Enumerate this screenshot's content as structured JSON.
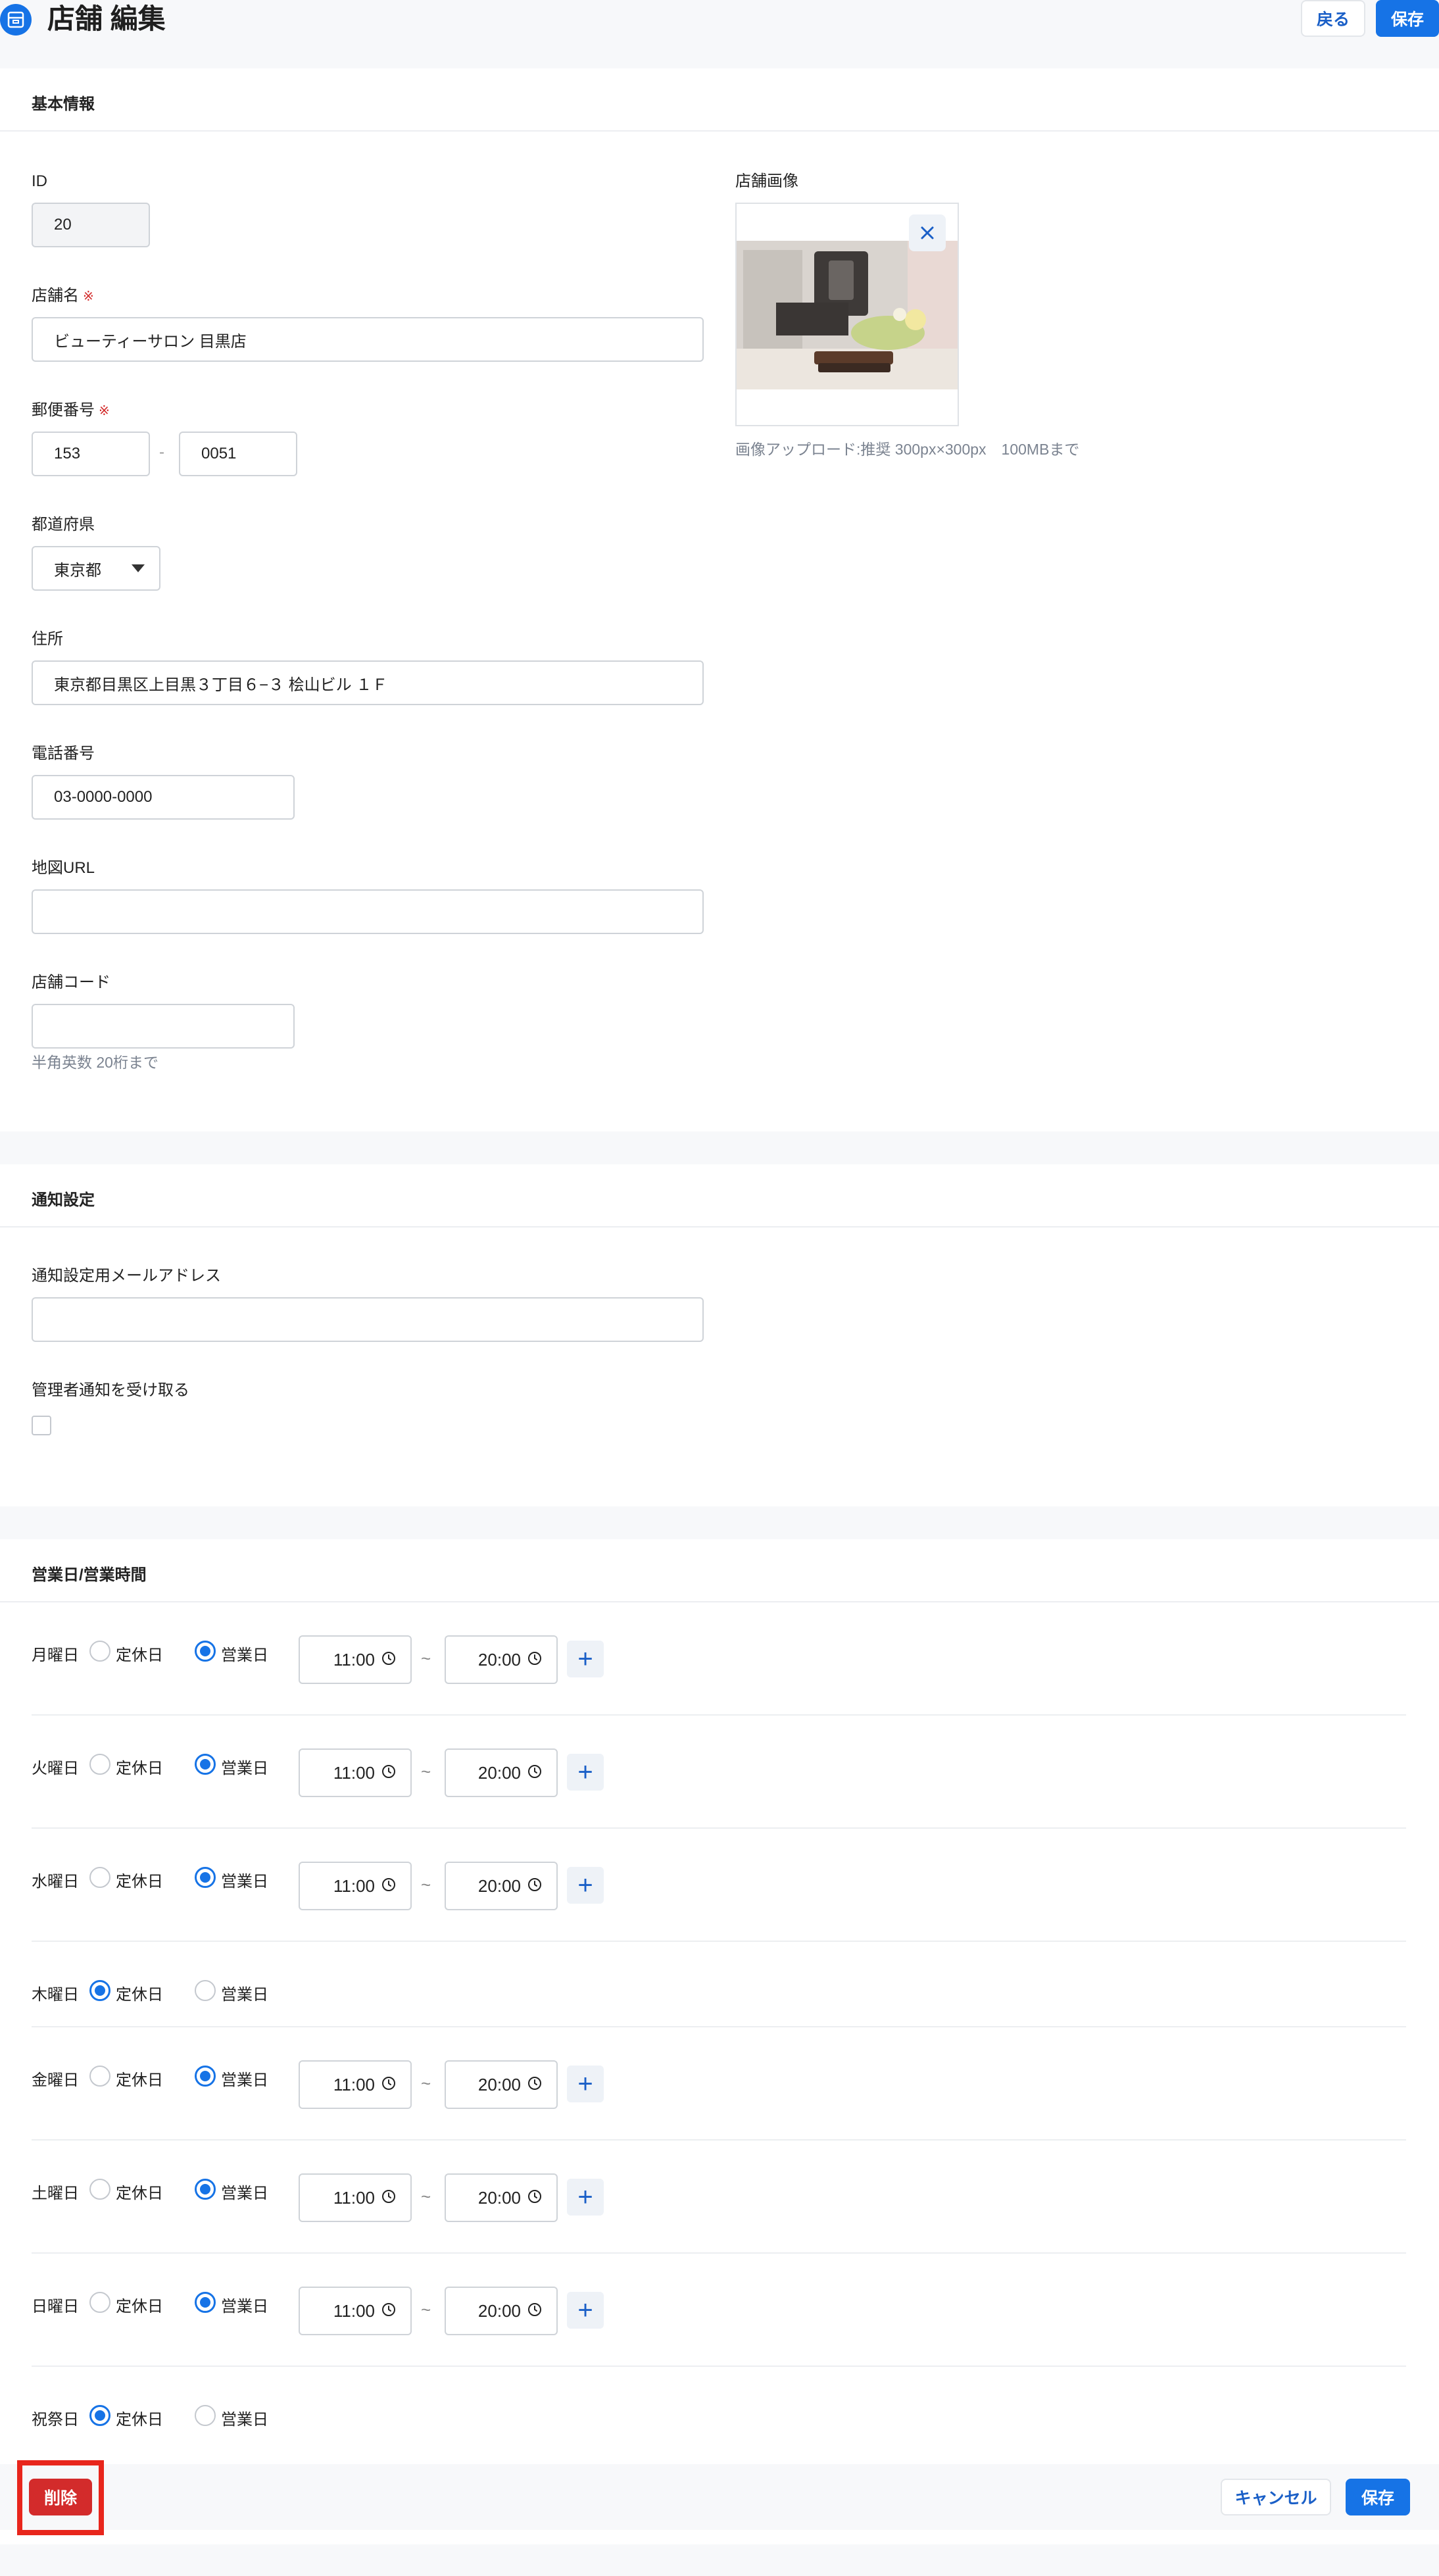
{
  "header": {
    "title": "店舗 編集",
    "back_label": "戻る",
    "save_label": "保存"
  },
  "basic": {
    "section_title": "基本情報",
    "id_label": "ID",
    "id_value": "20",
    "name_label": "店舗名",
    "name_value": "ビューティーサロン 目黒店",
    "required_mark": "※",
    "postal_label": "郵便番号",
    "postal1": "153",
    "postal_sep": "-",
    "postal2": "0051",
    "pref_label": "都道府県",
    "pref_value": "東京都",
    "address_label": "住所",
    "address_value": "東京都目黒区上目黒３丁目６−３ 桧山ビル １Ｆ",
    "phone_label": "電話番号",
    "phone_value": "03-0000-0000",
    "map_label": "地図URL",
    "map_value": "",
    "code_label": "店舗コード",
    "code_value": "",
    "code_hint": "半角英数 20桁まで",
    "image_label": "店舗画像",
    "image_hint": "画像アップロード:推奨 300px×300px　100MBまで"
  },
  "notify": {
    "section_title": "通知設定",
    "email_label": "通知設定用メールアドレス",
    "email_value": "",
    "admin_label": "管理者通知を受け取る",
    "admin_checked": false
  },
  "hours": {
    "section_title": "営業日/営業時間",
    "closed_label": "定休日",
    "open_label": "営業日",
    "days": [
      {
        "name": "月曜日",
        "open": true,
        "start": "11:00",
        "end": "20:00"
      },
      {
        "name": "火曜日",
        "open": true,
        "start": "11:00",
        "end": "20:00"
      },
      {
        "name": "水曜日",
        "open": true,
        "start": "11:00",
        "end": "20:00"
      },
      {
        "name": "木曜日",
        "open": false
      },
      {
        "name": "金曜日",
        "open": true,
        "start": "11:00",
        "end": "20:00"
      },
      {
        "name": "土曜日",
        "open": true,
        "start": "11:00",
        "end": "20:00"
      },
      {
        "name": "日曜日",
        "open": true,
        "start": "11:00",
        "end": "20:00"
      },
      {
        "name": "祝祭日",
        "open": false
      }
    ],
    "tilde": "~",
    "plus": "+"
  },
  "footer": {
    "delete_label": "削除",
    "cancel_label": "キャンセル",
    "save_label": "保存"
  },
  "colors": {
    "primary": "#1673e6",
    "danger": "#d32b2b",
    "highlight": "#e8261c"
  }
}
